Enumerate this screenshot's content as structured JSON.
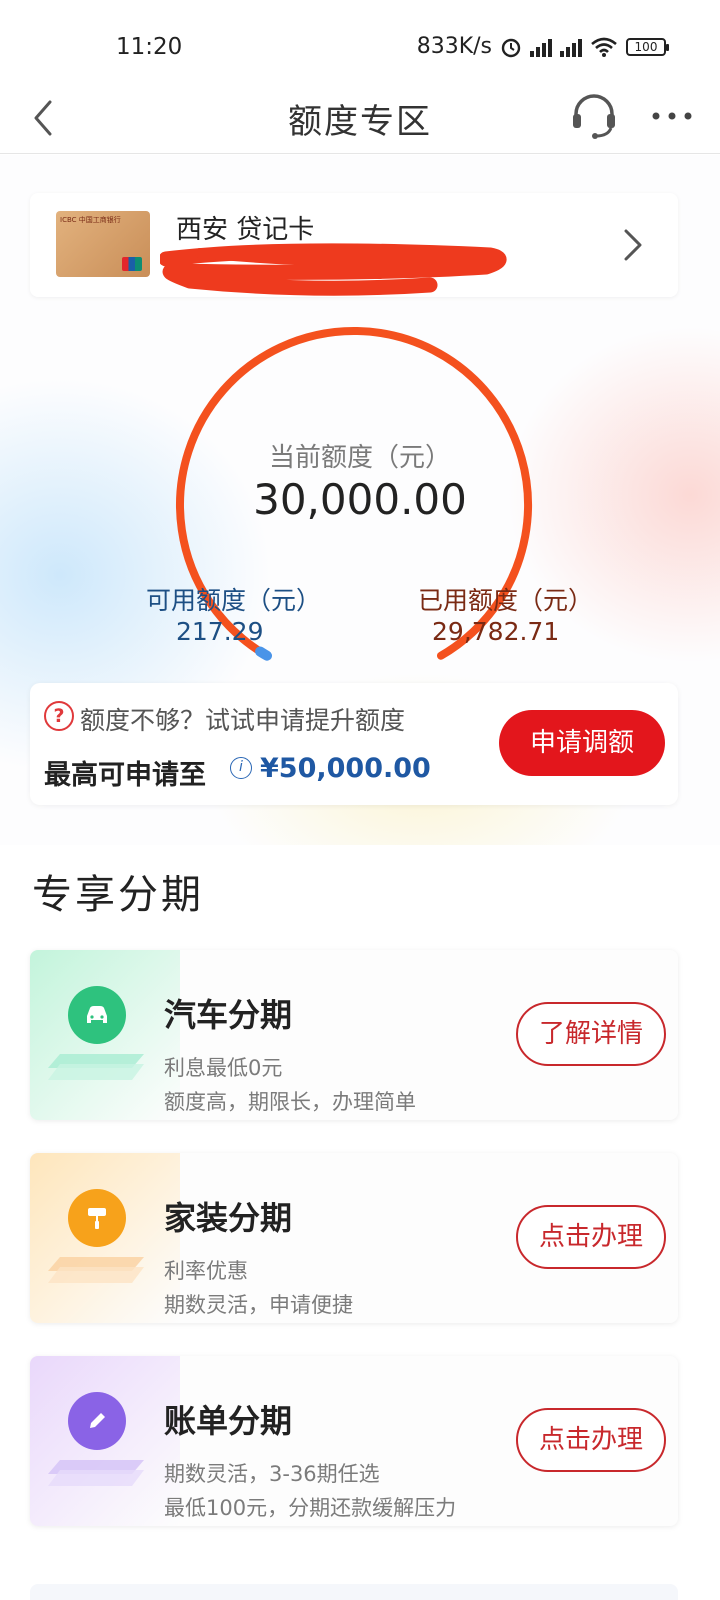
{
  "status_bar": {
    "time": "11:20",
    "net_speed": "833K/s",
    "battery": "100"
  },
  "nav": {
    "title": "额度专区"
  },
  "card": {
    "name": "西安 贷记卡",
    "bank_label": "ICBC 中国工商银行"
  },
  "credit": {
    "current_label": "当前额度（元）",
    "current_value": "30,000.00",
    "available_label": "可用额度（元）",
    "available_value": "217.29",
    "used_label": "已用额度（元）",
    "used_value": "29,782.71",
    "used_fraction": 0.9928
  },
  "raise": {
    "question": "额度不够？试试申请提升额度",
    "max_label": "最高可申请至",
    "max_amount": "¥50,000.00",
    "button": "申请调额"
  },
  "section": {
    "title": "专享分期"
  },
  "products": [
    {
      "title": "汽车分期",
      "sub1": "利息最低0元",
      "sub2": "额度高，期限长，办理简单",
      "button": "了解详情",
      "icon": "car-icon",
      "accent": "#2ec27e"
    },
    {
      "title": "家装分期",
      "sub1": "利率优惠",
      "sub2": "期数灵活，申请便捷",
      "button": "点击办理",
      "icon": "paint-roller-icon",
      "accent": "#f7a21b"
    },
    {
      "title": "账单分期",
      "sub1": "期数灵活，3-36期任选",
      "sub2": "最低100元，分期还款缓解压力",
      "button": "点击办理",
      "icon": "pencil-icon",
      "accent": "#8a63e6"
    }
  ],
  "colors": {
    "primary_red": "#e3161c",
    "gauge_orange": "#f4511e",
    "available_blue": "#1d4f84",
    "used_brown": "#7a2a14"
  }
}
